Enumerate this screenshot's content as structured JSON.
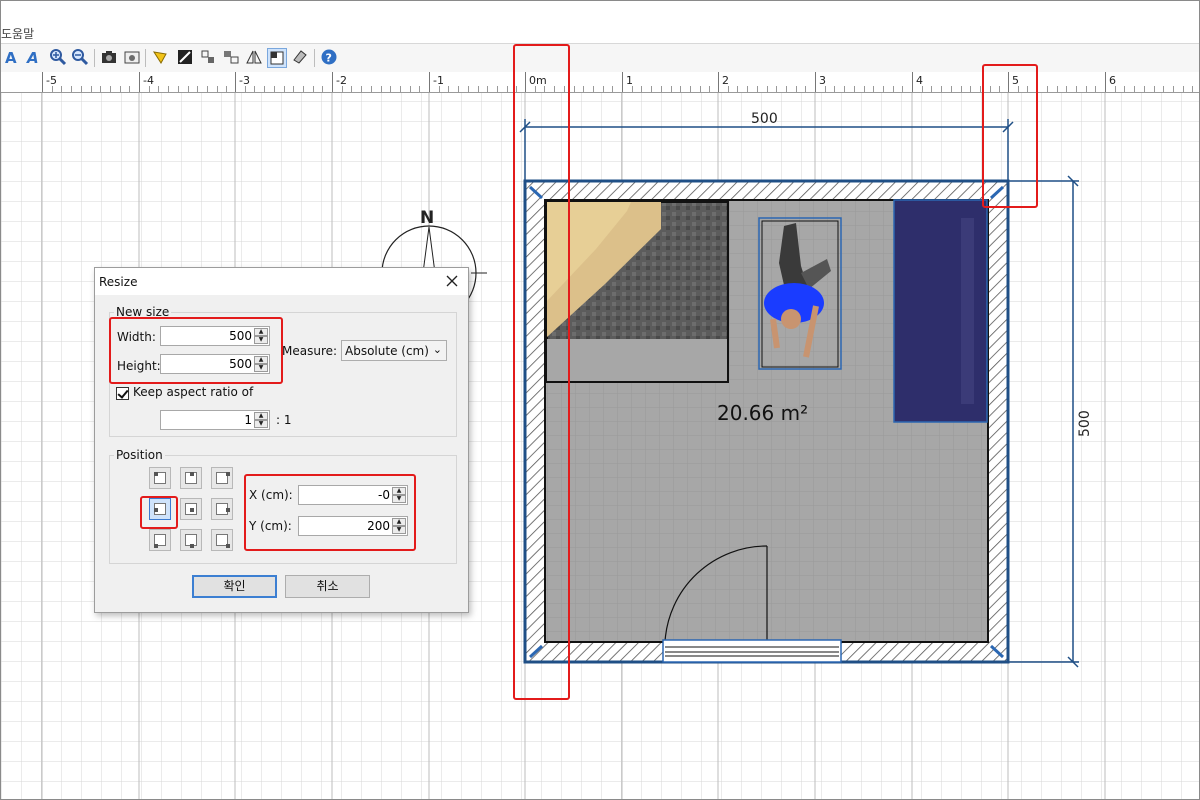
{
  "menubar": {
    "help_label": "도움말"
  },
  "toolbar": {
    "icons": [
      "text-style-icon",
      "text-italic-icon",
      "zoom-in-icon",
      "zoom-out-icon",
      "camera-icon",
      "photo-icon",
      "light-icon",
      "modify-icon",
      "flip-icon",
      "compass-icon",
      "mirror-icon",
      "select-icon",
      "pan-icon",
      "help-icon"
    ]
  },
  "ruler": {
    "labels": [
      "-5",
      "-4",
      "-3",
      "-2",
      "-1",
      "0m",
      "1",
      "2",
      "3",
      "4",
      "5",
      "6"
    ]
  },
  "plan": {
    "top_dimension": "500",
    "right_dimension": "500",
    "room_area": "20.66 m²",
    "compass_label": "N"
  },
  "dialog": {
    "title": "Resize",
    "new_size_legend": "New size",
    "width_label": "Width:",
    "width_value": "500",
    "height_label": "Height:",
    "height_value": "500",
    "measure_label": "Measure:",
    "measure_value": "Absolute (cm)",
    "keep_aspect_label": "Keep aspect ratio of",
    "keep_aspect_checked": true,
    "ratio_value": "1",
    "ratio_suffix": ": 1",
    "position_legend": "Position",
    "x_label": "X (cm):",
    "x_value": "-0",
    "y_label": "Y (cm):",
    "y_value": "200",
    "selected_anchor": "middle-left",
    "ok_label": "확인",
    "cancel_label": "취소"
  },
  "colors": {
    "highlight_red": "#e31b1b",
    "room_floor": "#a6a6a6",
    "wall_outline": "#1f4f86",
    "bed": "#2e2e6b",
    "person_shirt": "#1a3cff"
  }
}
